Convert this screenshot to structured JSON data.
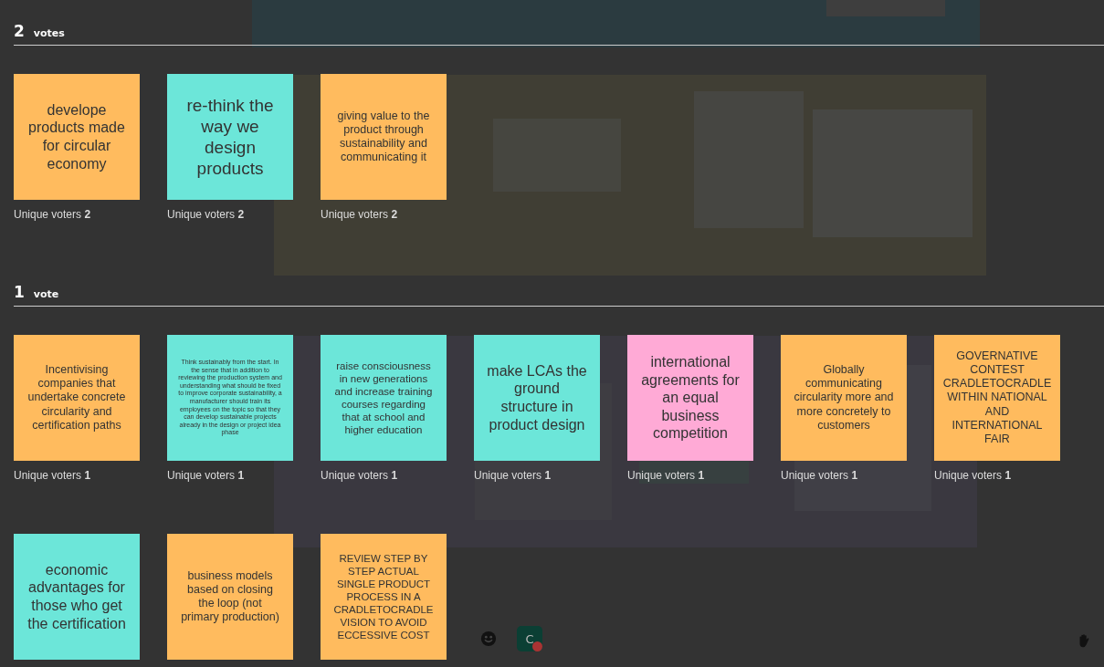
{
  "groups": [
    {
      "count": "2",
      "unit": "votes",
      "notes": [
        {
          "text": "develope products made for circular economy",
          "color": "#ffbb5e",
          "voters": "Unique voters **2**"
        },
        {
          "text": "re-think the way we design products",
          "color": "#6ce6d9",
          "voters": "Unique voters **2**"
        },
        {
          "text": "giving value to the product through sustainability and communicating it",
          "color": "#ffbb5e",
          "voters": "Unique voters **2**"
        }
      ]
    },
    {
      "count": "1",
      "unit": "vote",
      "notes": [
        {
          "text": "Incentivising companies that undertake concrete circularity and certification paths",
          "color": "#ffbb5e",
          "voters": "Unique voters **1**"
        },
        {
          "text": "Think sustainably from the start. In the sense that in addition to reviewing the production system and understanding what should be fixed to improve corporate sustainability, a manufacturer should train its employees on the topic so that they can develop sustainable projects already in the design or project idea phase",
          "color": "#6ce6d9",
          "voters": "Unique voters **1**"
        },
        {
          "text": "raise consciousness in new generations and increase training courses regarding that at school and higher education",
          "color": "#6ce6d9",
          "voters": "Unique voters **1**"
        },
        {
          "text": "make LCAs the ground structure in product design",
          "color": "#6ce6d9",
          "voters": "Unique voters **1**"
        },
        {
          "text": "international agreements for an equal business competition",
          "color": "#ffaad6",
          "voters": "Unique voters **1**"
        },
        {
          "text": "Globally communicating circularity more and more concretely to customers",
          "color": "#ffbb5e",
          "voters": "Unique voters **1**"
        },
        {
          "text": "GOVERNATIVE CONTEST CRADLETOCRADLE WITHIN NATIONAL AND INTERNATIONAL FAIR",
          "color": "#ffbb5e",
          "voters": "Unique voters **1**"
        },
        {
          "text": "economic advantages for those who get the certification",
          "color": "#6ce6d9"
        },
        {
          "text": "business models based on closing the loop (not primary production)",
          "color": "#ffbb5e"
        },
        {
          "text": "REVIEW STEP BY STEP ACTUAL SINGLE PRODUCT PROCESS IN A CRADLETOCRADLE VISION TO AVOID ECCESSIVE COST",
          "color": "#ffbb5e"
        }
      ]
    }
  ],
  "toolbar": {
    "avatar": "C"
  }
}
